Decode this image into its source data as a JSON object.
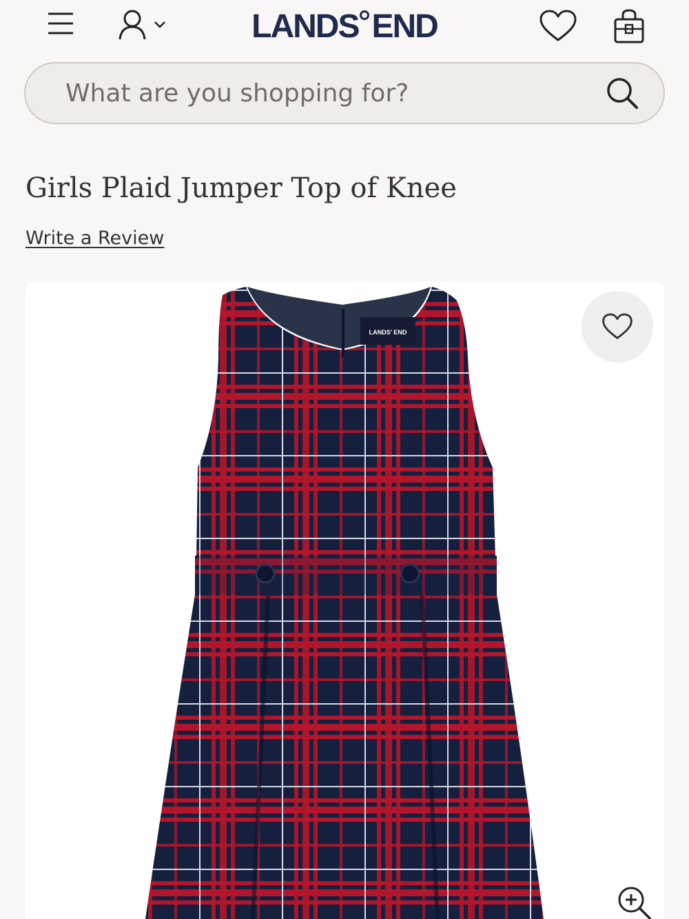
{
  "header": {
    "menu_icon": "hamburger-menu-icon",
    "account_icon": "user-icon",
    "account_dropdown_icon": "chevron-down-icon",
    "logo_left": "LANDS",
    "logo_right": "END",
    "wishlist_icon": "heart-icon",
    "bag_icon": "shopping-bag-icon"
  },
  "search": {
    "placeholder": "What are you shopping for?",
    "icon": "search-icon"
  },
  "product": {
    "title": "Girls Plaid Jumper Top of Knee",
    "review_link": "Write a Review",
    "image_wishlist_icon": "heart-icon",
    "zoom_icon": "zoom-in-icon",
    "garment_label": "LANDS' END"
  },
  "colors": {
    "brand_navy": "#1f2a4d",
    "plaid_navy": "#15203f",
    "plaid_red": "#b3162b",
    "page_background": "#f9f7f5"
  }
}
